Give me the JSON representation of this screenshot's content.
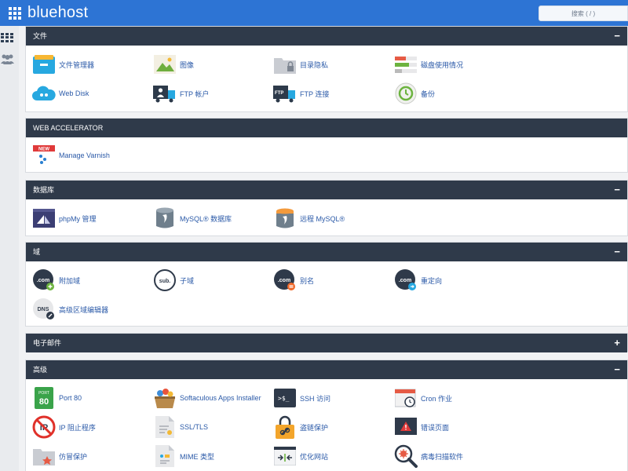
{
  "header": {
    "logo_text": "bluehost",
    "search_placeholder": "搜索 ( / )"
  },
  "sections": {
    "files": {
      "title": "文件",
      "toggle": "−",
      "items": [
        {
          "label": "文件管理器",
          "icon": "file-manager-icon"
        },
        {
          "label": "图像",
          "icon": "images-icon"
        },
        {
          "label": "目录隐私",
          "icon": "directory-privacy-icon"
        },
        {
          "label": "磁盘使用情况",
          "icon": "disk-usage-icon"
        },
        {
          "label": "Web Disk",
          "icon": "web-disk-icon"
        },
        {
          "label": "FTP 帐户",
          "icon": "ftp-accounts-icon"
        },
        {
          "label": "FTP 连接",
          "icon": "ftp-connections-icon"
        },
        {
          "label": "备份",
          "icon": "backup-icon"
        }
      ]
    },
    "web_accelerator": {
      "title": "WEB ACCELERATOR",
      "items": [
        {
          "label": "Manage Varnish",
          "icon": "varnish-icon",
          "badge": "NEW"
        }
      ]
    },
    "databases": {
      "title": "数据库",
      "toggle": "−",
      "items": [
        {
          "label": "phpMy 管理",
          "icon": "phpmyadmin-icon"
        },
        {
          "label": "MySQL® 数据库",
          "icon": "mysql-database-icon"
        },
        {
          "label": "远程 MySQL®",
          "icon": "remote-mysql-icon"
        }
      ]
    },
    "domains": {
      "title": "域",
      "toggle": "−",
      "items": [
        {
          "label": "附加域",
          "icon": "addon-domain-icon",
          "icon_text": ".com"
        },
        {
          "label": "子域",
          "icon": "subdomain-icon",
          "icon_text": "sub."
        },
        {
          "label": "别名",
          "icon": "alias-icon",
          "icon_text": ".com"
        },
        {
          "label": "重定向",
          "icon": "redirect-icon",
          "icon_text": ".com"
        },
        {
          "label": "高级区域编辑器",
          "icon": "zone-editor-icon",
          "icon_text": "DNS"
        }
      ]
    },
    "email": {
      "title": "电子邮件",
      "toggle": "+"
    },
    "advanced": {
      "title": "高级",
      "toggle": "−",
      "items": [
        {
          "label": "Port 80",
          "icon": "port80-icon",
          "icon_text_top": "PORT",
          "icon_text_main": "80"
        },
        {
          "label": "Softaculous Apps Installer",
          "icon": "softaculous-icon"
        },
        {
          "label": "SSH 访问",
          "icon": "ssh-icon",
          "icon_text": ">$_"
        },
        {
          "label": "Cron 作业",
          "icon": "cron-icon"
        },
        {
          "label": "IP 阻止程序",
          "icon": "ip-blocker-icon",
          "icon_text": "IP"
        },
        {
          "label": "SSL/TLS",
          "icon": "ssl-icon"
        },
        {
          "label": "盗链保护",
          "icon": "hotlink-protection-icon"
        },
        {
          "label": "错误页面",
          "icon": "error-pages-icon"
        },
        {
          "label": "仿冒保护",
          "icon": "leech-protection-icon"
        },
        {
          "label": "MIME 类型",
          "icon": "mime-types-icon"
        },
        {
          "label": "优化网站",
          "icon": "optimize-website-icon"
        },
        {
          "label": "病毒扫描软件",
          "icon": "virus-scanner-icon"
        }
      ]
    }
  },
  "colors": {
    "topbar": "#2d74d4",
    "panel_header": "#2f3a4a",
    "link": "#2b5aa8"
  }
}
